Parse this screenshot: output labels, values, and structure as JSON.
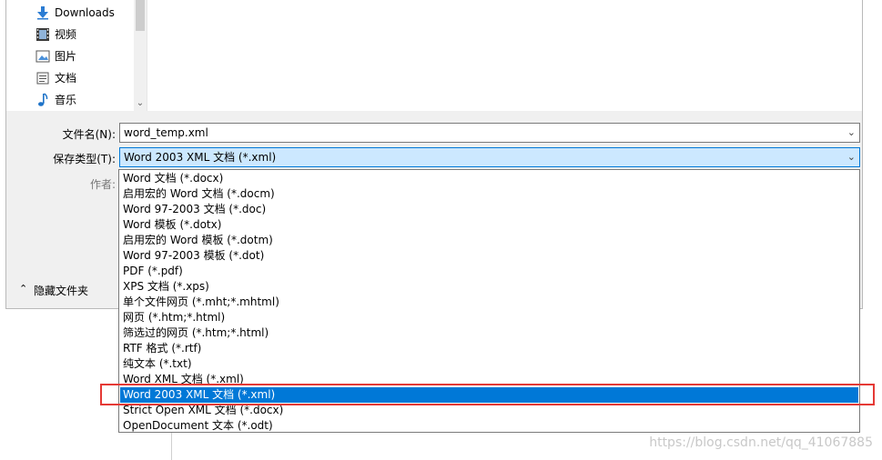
{
  "navigation": {
    "items": [
      {
        "label": "Downloads",
        "icon": "download-arrow-icon"
      },
      {
        "label": "视频",
        "icon": "video-icon"
      },
      {
        "label": "图片",
        "icon": "picture-icon"
      },
      {
        "label": "文档",
        "icon": "document-icon"
      },
      {
        "label": "音乐",
        "icon": "music-note-icon"
      }
    ]
  },
  "form": {
    "filename_label": "文件名(N):",
    "filename_value": "word_temp.xml",
    "savetype_label": "保存类型(T):",
    "savetype_value": "Word 2003 XML 文档 (*.xml)",
    "author_label": "作者:"
  },
  "hide_folders_label": "隐藏文件夹",
  "dropdown": {
    "options": [
      "Word 文档 (*.docx)",
      "启用宏的 Word 文档 (*.docm)",
      "Word 97-2003 文档 (*.doc)",
      "Word 模板 (*.dotx)",
      "启用宏的 Word 模板 (*.dotm)",
      "Word 97-2003 模板 (*.dot)",
      "PDF (*.pdf)",
      "XPS 文档 (*.xps)",
      "单个文件网页 (*.mht;*.mhtml)",
      "网页 (*.htm;*.html)",
      "筛选过的网页 (*.htm;*.html)",
      "RTF 格式 (*.rtf)",
      "纯文本 (*.txt)",
      "Word XML 文档 (*.xml)",
      "Word 2003 XML 文档 (*.xml)",
      "Strict Open XML 文档 (*.docx)",
      "OpenDocument 文本 (*.odt)"
    ],
    "selected_index": 14
  },
  "watermark": "https://blog.csdn.net/qq_41067885",
  "colors": {
    "selection": "#0078d7",
    "annotation_border": "#e53935"
  }
}
